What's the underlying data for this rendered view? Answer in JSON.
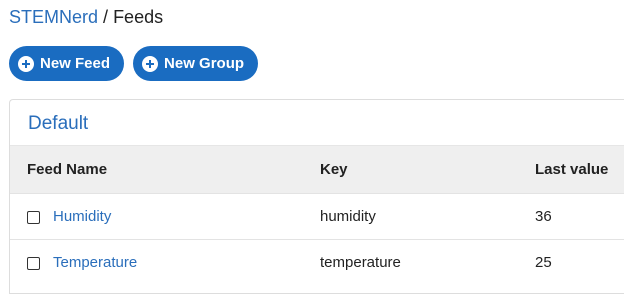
{
  "breadcrumb": {
    "root": "STEMNerd",
    "separator": "/",
    "current": "Feeds"
  },
  "toolbar": {
    "new_feed_label": "New Feed",
    "new_feed_icon": "plus-circle-icon",
    "new_group_label": "New Group",
    "new_group_icon": "plus-circle-icon"
  },
  "group": {
    "title": "Default",
    "columns": {
      "name": "Feed Name",
      "key": "Key",
      "last_value": "Last value"
    },
    "rows": [
      {
        "name": "Humidity",
        "key": "humidity",
        "last_value": "36"
      },
      {
        "name": "Temperature",
        "key": "temperature",
        "last_value": "25"
      }
    ]
  },
  "colors": {
    "accent": "#1a6cc1",
    "link": "#2a6ebb",
    "header_bg": "#efefef"
  }
}
